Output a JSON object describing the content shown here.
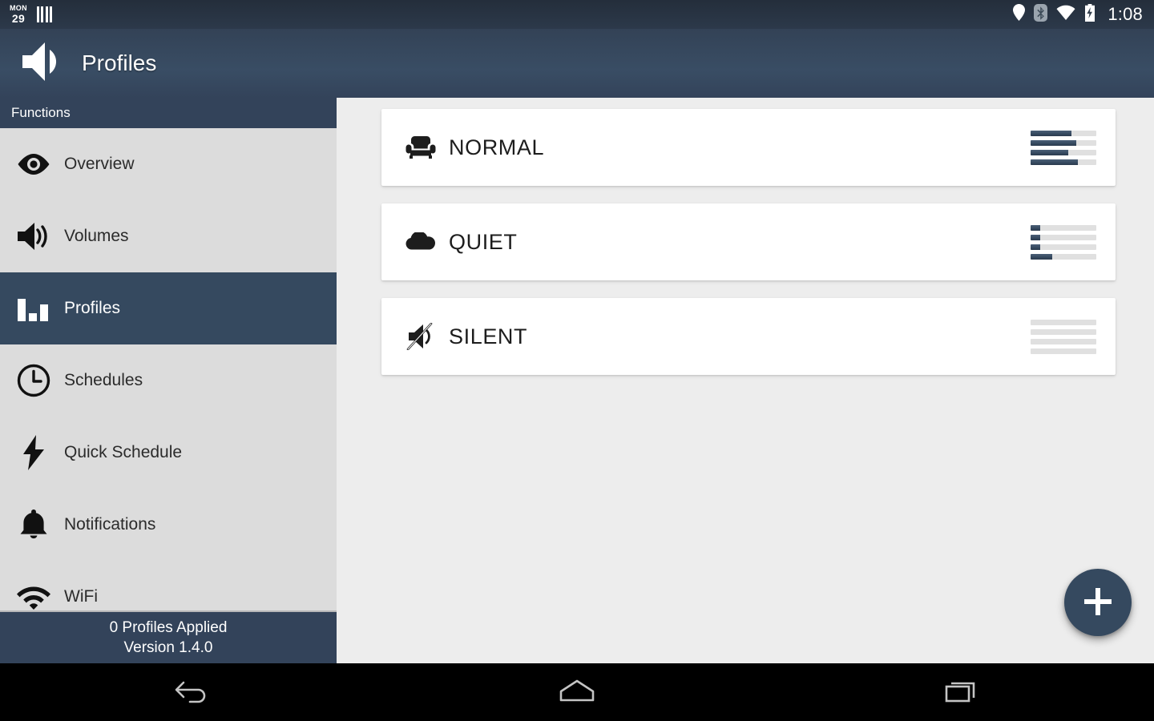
{
  "status_bar": {
    "day_label": "MON",
    "day_number": "29",
    "barcode_icon": "barcode-icon",
    "icons": [
      "location-pin-icon",
      "bluetooth-icon",
      "wifi-icon",
      "battery-charging-icon"
    ],
    "time": "1:08"
  },
  "action_bar": {
    "app_icon": "speaker-volume-icon",
    "title": "Profiles"
  },
  "sidebar": {
    "header": "Functions",
    "items": [
      {
        "label": "Overview",
        "icon": "eye-icon",
        "active": false
      },
      {
        "label": "Volumes",
        "icon": "speaker-waves-icon",
        "active": false
      },
      {
        "label": "Profiles",
        "icon": "bar-chart-icon",
        "active": true
      },
      {
        "label": "Schedules",
        "icon": "clock-icon",
        "active": false
      },
      {
        "label": "Quick Schedule",
        "icon": "lightning-bolt-icon",
        "active": false
      },
      {
        "label": "Notifications",
        "icon": "bell-icon",
        "active": false
      },
      {
        "label": "WiFi",
        "icon": "wifi-icon",
        "active": false
      }
    ],
    "footer": {
      "profiles_applied": "0 Profiles Applied",
      "version": "Version 1.4.0"
    }
  },
  "profiles": [
    {
      "name": "NORMAL",
      "icon": "armchair-icon",
      "volume_bars": [
        62,
        70,
        57,
        72
      ]
    },
    {
      "name": "QUIET",
      "icon": "cloud-icon",
      "volume_bars": [
        15,
        15,
        15,
        33
      ]
    },
    {
      "name": "SILENT",
      "icon": "speaker-muted-icon",
      "volume_bars": [
        0,
        0,
        0,
        0
      ]
    }
  ],
  "fab": {
    "icon": "plus-icon",
    "label": "Add profile"
  },
  "nav_bar": {
    "buttons": [
      "back-icon",
      "home-icon",
      "recents-icon"
    ]
  },
  "colors": {
    "accent": "#35495f",
    "action_bar": "#394d64",
    "sidebar_bg": "#dcdcdc",
    "content_bg": "#ededed",
    "bar_fill": "#35495f",
    "bar_track": "#e0e0e0"
  }
}
